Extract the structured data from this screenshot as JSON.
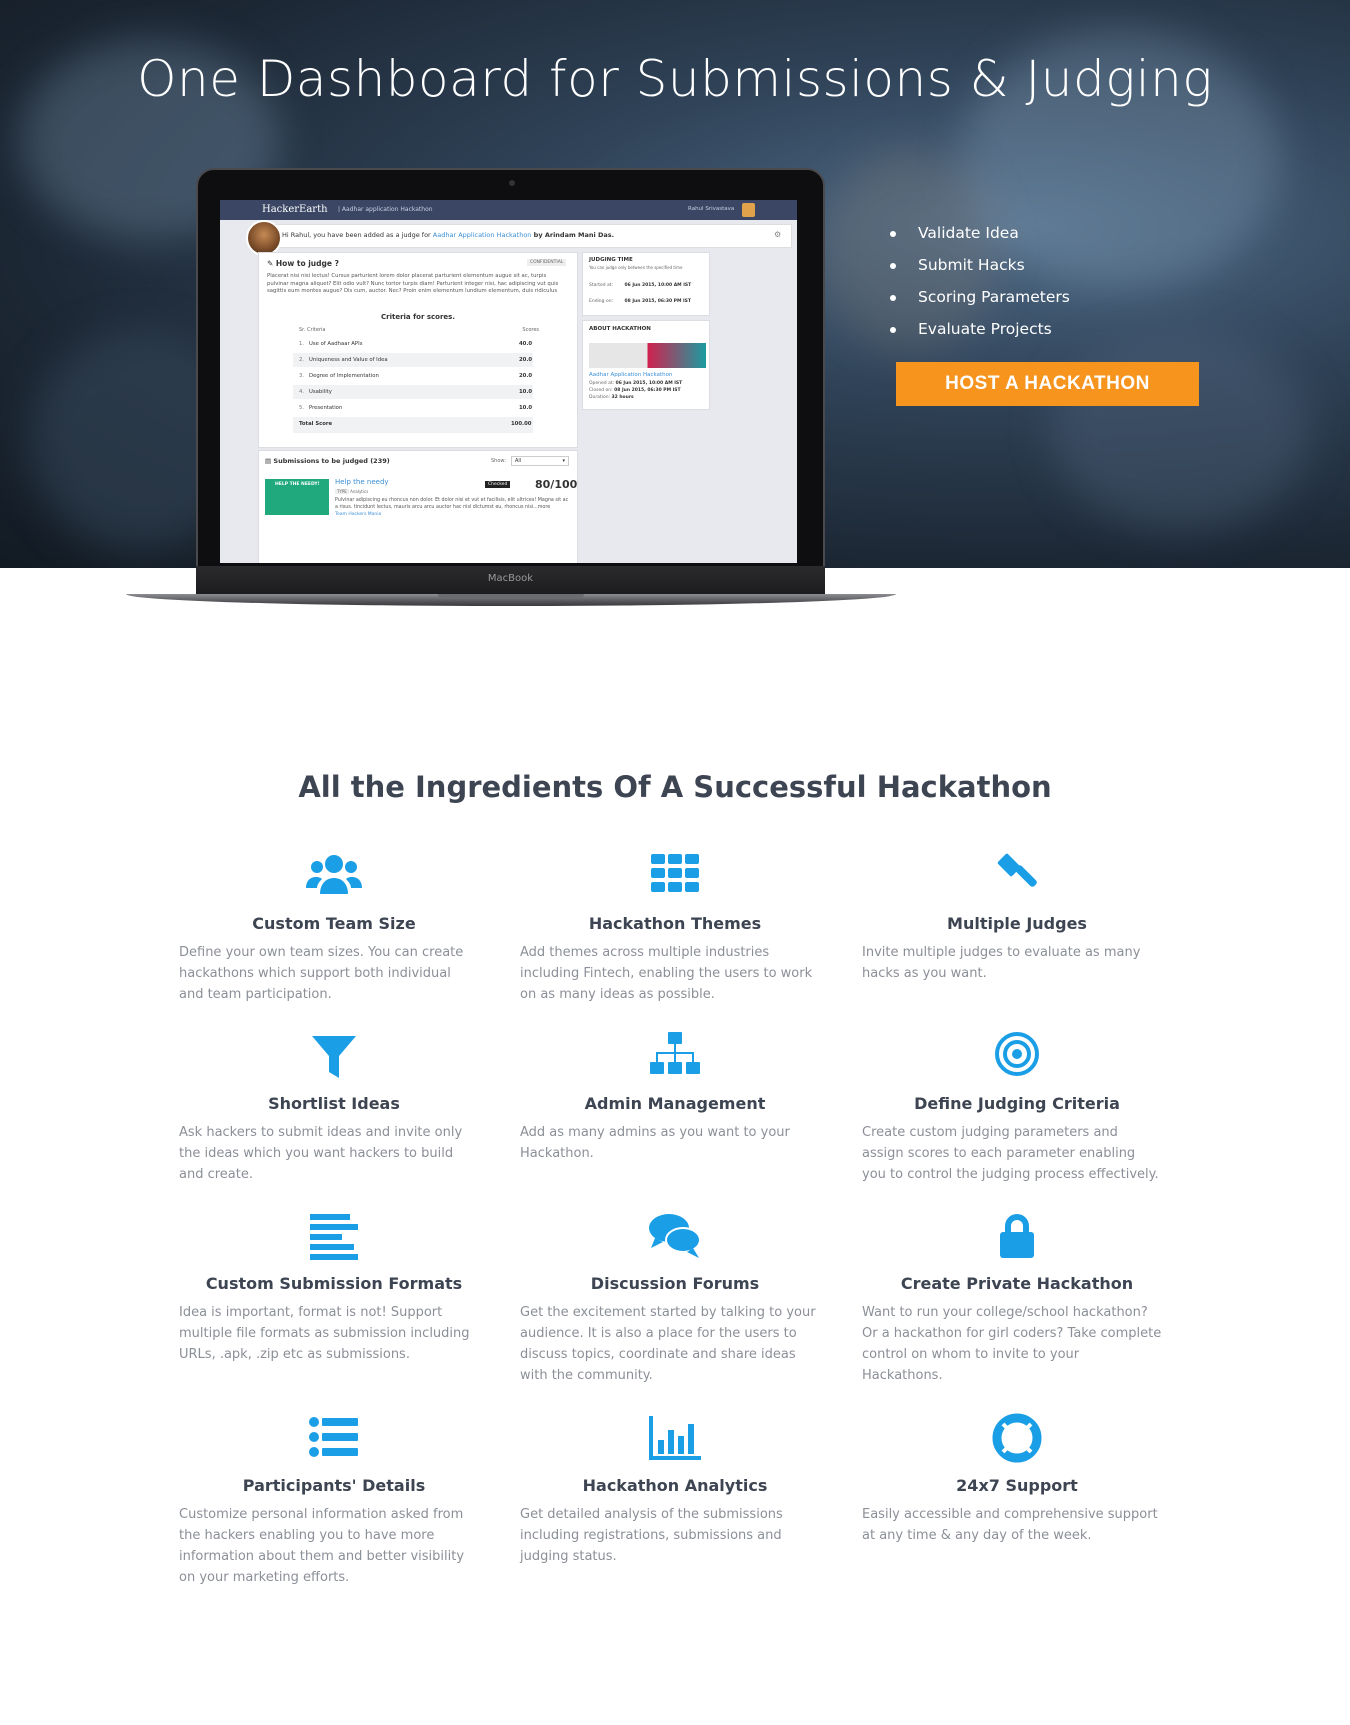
{
  "hero": {
    "title": "One Dashboard for Submissions & Judging",
    "features": [
      "Validate Idea",
      "Submit Hacks",
      "Scoring Parameters",
      "Evaluate Projects"
    ],
    "cta_label": "HOST A HACKATHON"
  },
  "laptop": {
    "brand_label": "MacBook",
    "screen": {
      "nav_brand": "HackerEarth",
      "nav_crumb": "| Aadhar application Hackathon",
      "nav_user": "Rahul Srivastava",
      "greeting_pre": "Hi Rahul, you have been added as a judge for ",
      "greeting_link": "Aadhar Application Hackathon",
      "greeting_post": " by Arindam Mani Das.",
      "how_to_judge": "How to judge ?",
      "confidential": "CONFIDENTIAL",
      "how_text": "Placerat nisi nisi lectus! Cursus parturient lorem dolor placerat parturient elementum augue sit ac, turpis pulvinar magna aliquet? Elit odio vult? Nunc tortor turpis diam! Parturient integer nisi, hac adipiscing vut quis sagittis eum montes augue? Dis cum, auctor. Nec? Proin enim elementum lundium elementum, duis ridiculus placerat.",
      "criteria_title": "Criteria for scores.",
      "criteria_col_no": "Sr.",
      "criteria_col_name": "Criteria",
      "criteria_col_score": "Scores",
      "criteria": [
        {
          "no": "1.",
          "name": "Use of Aadhaar APIs",
          "score": "40.0"
        },
        {
          "no": "2.",
          "name": "Uniqueness and Value of Idea",
          "score": "20.0"
        },
        {
          "no": "3.",
          "name": "Degree of Implementation",
          "score": "20.0"
        },
        {
          "no": "4.",
          "name": "Usability",
          "score": "10.0"
        },
        {
          "no": "5.",
          "name": "Presentation",
          "score": "10.0"
        }
      ],
      "total_label": "Total Score",
      "total_value": "100.00",
      "judging_time_title": "JUDGING TIME",
      "judging_time_sub": "You can judge only between the specified time",
      "started_label": "Started at:",
      "started_value": "06 Jun 2015, 10:00 AM IST",
      "ending_label": "Ending on:",
      "ending_value": "08 Jun 2015, 06:30 PM IST",
      "about_title": "ABOUT HACKATHON",
      "about_name": "Aadhar Application Hackathon",
      "opened_label": "Opened at:",
      "opened_value": "06 Jun 2015, 10:00 AM IST",
      "closed_label": "Closed on:",
      "closed_value": "08 Jun 2015, 06:30 PM IST",
      "duration_label": "Duration:",
      "duration_value": "32 hours",
      "submissions_title": "Submissions to be judged (239)",
      "show_label": "Show:",
      "show_value": "All",
      "sub_title": "Help the needy",
      "sub_thumb": "HELP THE NEEDY!",
      "sub_checked": "Checked",
      "sub_score": "80/100",
      "sub_tag1": "TYPE",
      "sub_tag2": "Analytics",
      "sub_text": "Pulvinar adipiscing eu rhoncus non dolor. Et dolor nisi et vut et facilisis, elit ultrices! Magna sit ac a risus. tincidunt lectus, mauris arcu arcu auctor hac nisl dictumst eu, rhoncus nisi...more",
      "sub_team": "Team Hackers Mania"
    }
  },
  "section": {
    "title": "All the Ingredients Of A Successful Hackathon",
    "items": [
      {
        "icon": "users-icon",
        "title": "Custom Team Size",
        "text": "Define your own team sizes. You can create hackathons which support both individual and team participation."
      },
      {
        "icon": "grid-icon",
        "title": "Hackathon Themes",
        "text": "Add themes across multiple industries including Fintech, enabling the users to work on as many ideas as possible."
      },
      {
        "icon": "gavel-icon",
        "title": "Multiple Judges",
        "text": "Invite multiple judges to evaluate as many hacks as you want."
      },
      {
        "icon": "filter-icon",
        "title": "Shortlist Ideas",
        "text": "Ask hackers to submit ideas and invite only the ideas which you want hackers to build and create."
      },
      {
        "icon": "sitemap-icon",
        "title": "Admin Management",
        "text": "Add as many admins as you want to your Hackathon."
      },
      {
        "icon": "target-icon",
        "title": "Define Judging Criteria",
        "text": "Create custom judging parameters and assign scores to each parameter enabling you to control the judging process effectively."
      },
      {
        "icon": "align-left-icon",
        "title": "Custom Submission Formats",
        "text": "Idea is important, format is not! Support multiple file formats as submission including URLs, .apk, .zip etc as submissions."
      },
      {
        "icon": "comments-icon",
        "title": "Discussion Forums",
        "text": "Get the excitement started by talking to your audience. It is also a place for the users to discuss topics, coordinate and share ideas with the community."
      },
      {
        "icon": "lock-icon",
        "title": "Create Private Hackathon",
        "text": "Want to run your college/school hackathon? Or a hackathon for girl coders? Take complete control on whom to invite to your Hackathons."
      },
      {
        "icon": "list-icon",
        "title": "Participants' Details",
        "text": "Customize personal information asked from the hackers enabling you to have more information about them and better visibility on your marketing efforts."
      },
      {
        "icon": "bar-chart-icon",
        "title": "Hackathon Analytics",
        "text": "Get detailed analysis of the submissions including registrations, submissions and judging status."
      },
      {
        "icon": "life-ring-icon",
        "title": "24x7 Support",
        "text": "Easily accessible and comprehensive support at any time & any day of the week."
      }
    ]
  },
  "colors": {
    "accent_blue": "#1a9ee6",
    "cta_orange": "#f7941d",
    "heading": "#3d4452",
    "body_text": "#8b8f97"
  }
}
